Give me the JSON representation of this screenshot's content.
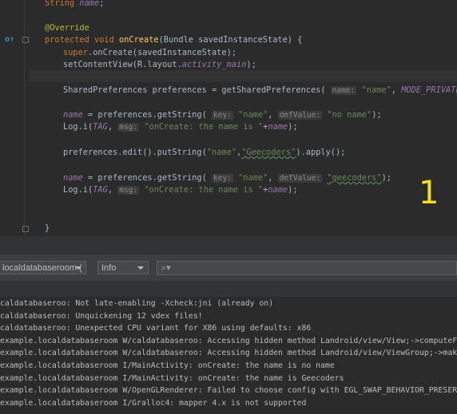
{
  "editor": {
    "lines": [
      {
        "segments": [
          {
            "t": "String ",
            "c": "kw"
          },
          {
            "t": "name",
            "c": "fld"
          },
          {
            "t": ";",
            "c": ""
          }
        ]
      },
      {
        "segments": [
          {
            "t": "@Override",
            "c": "ann"
          }
        ]
      },
      {
        "segments": [
          {
            "t": "protected void ",
            "c": "kw"
          },
          {
            "t": "onCreate",
            "c": "fn"
          },
          {
            "t": "(Bundle savedInstanceState) {",
            "c": ""
          }
        ]
      },
      {
        "segments": [
          {
            "t": "super",
            "c": "kw"
          },
          {
            "t": ".onCreate(savedInstanceState);",
            "c": ""
          }
        ]
      },
      {
        "segments": [
          {
            "t": "setContentView(R.layout.",
            "c": ""
          },
          {
            "t": "activity_main",
            "c": "fld"
          },
          {
            "t": ");",
            "c": ""
          }
        ]
      },
      {
        "segments": [
          {
            "t": "SharedPreferences preferences = getSharedPreferences( ",
            "c": ""
          },
          {
            "t": "name:",
            "c": "hint"
          },
          {
            "t": " ",
            "c": ""
          },
          {
            "t": "\"name\"",
            "c": "str"
          },
          {
            "t": ", ",
            "c": ""
          },
          {
            "t": "MODE_PRIVATE",
            "c": "fld"
          },
          {
            "t": ");",
            "c": ""
          }
        ]
      },
      {
        "segments": [
          {
            "t": "name",
            "c": "fld"
          },
          {
            "t": " = preferences.getString( ",
            "c": ""
          },
          {
            "t": "key:",
            "c": "hint"
          },
          {
            "t": " ",
            "c": ""
          },
          {
            "t": "\"name\"",
            "c": "str"
          },
          {
            "t": ", ",
            "c": ""
          },
          {
            "t": "defValue:",
            "c": "hint"
          },
          {
            "t": " ",
            "c": ""
          },
          {
            "t": "\"no name\"",
            "c": "str"
          },
          {
            "t": ");",
            "c": ""
          }
        ]
      },
      {
        "segments": [
          {
            "t": "Log.i(",
            "c": ""
          },
          {
            "t": "TAG",
            "c": "fld"
          },
          {
            "t": ", ",
            "c": ""
          },
          {
            "t": "msg:",
            "c": "hint"
          },
          {
            "t": " ",
            "c": ""
          },
          {
            "t": "\"onCreate: the name is \"",
            "c": "str"
          },
          {
            "t": "+",
            "c": ""
          },
          {
            "t": "name",
            "c": "fld"
          },
          {
            "t": ");",
            "c": ""
          }
        ]
      },
      {
        "segments": [
          {
            "t": "preferences.edit().putString(",
            "c": ""
          },
          {
            "t": "\"name\"",
            "c": "str"
          },
          {
            "t": ",",
            "c": ""
          },
          {
            "t": "\"Geecoders\"",
            "c": "str typo"
          },
          {
            "t": ").apply();",
            "c": ""
          }
        ]
      },
      {
        "segments": [
          {
            "t": "name",
            "c": "fld"
          },
          {
            "t": " = preferences.getString( ",
            "c": ""
          },
          {
            "t": "key:",
            "c": "hint"
          },
          {
            "t": " ",
            "c": ""
          },
          {
            "t": "\"name\"",
            "c": "str"
          },
          {
            "t": ", ",
            "c": ""
          },
          {
            "t": "defValue:",
            "c": "hint"
          },
          {
            "t": " ",
            "c": ""
          },
          {
            "t": "\"geecoders\"",
            "c": "str typo"
          },
          {
            "t": ");",
            "c": ""
          }
        ]
      },
      {
        "segments": [
          {
            "t": "Log.i(",
            "c": ""
          },
          {
            "t": "TAG",
            "c": "fld"
          },
          {
            "t": ", ",
            "c": ""
          },
          {
            "t": "msg:",
            "c": "hint"
          },
          {
            "t": " ",
            "c": ""
          },
          {
            "t": "\"onCreate: the name is \"",
            "c": "str"
          },
          {
            "t": "+",
            "c": ""
          },
          {
            "t": "name",
            "c": "fld"
          },
          {
            "t": ");",
            "c": ""
          }
        ]
      },
      {
        "segments": [
          {
            "t": "}",
            "c": ""
          }
        ]
      }
    ],
    "overlay_number": "1"
  },
  "logcat": {
    "process_selector": "localdatabaseroom (",
    "level_selector": "Info",
    "search": {
      "value": "",
      "placeholder": ""
    },
    "lines": [
      "caldatabaseroo: Not late-enabling -Xcheck:jni (already on)",
      "caldatabaseroo: Unquickening 12 vdex files!",
      "caldatabaseroo: Unexpected CPU variant for X86 using defaults: x86",
      "example.localdatabaseroom W/caldatabaseroo: Accessing hidden method Landroid/view/View;->computeFitSystem",
      "example.localdatabaseroom W/caldatabaseroo: Accessing hidden method Landroid/view/ViewGroup;->makeOptiona",
      "example.localdatabaseroom I/MainActivity: onCreate: the name is no name",
      "example.localdatabaseroom I/MainActivity: onCreate: the name is Geecoders",
      "example.localdatabaseroom W/OpenGLRenderer: Failed to choose config with EGL_SWAP_BEHAVIOR_PRESERVED, ret",
      "example.localdatabaseroom I/Gralloc4: mapper 4.x is not supported"
    ]
  }
}
